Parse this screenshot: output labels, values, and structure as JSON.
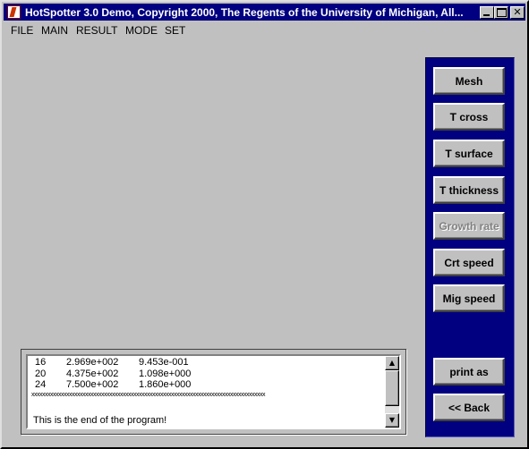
{
  "window": {
    "title": "HotSpotter 3.0 Demo,  Copyright 2000,  The Regents of the University of Michigan,  All...",
    "icon": "matlab-icon"
  },
  "menu": [
    "FILE",
    "MAIN",
    "RESULT",
    "MODE",
    "SET"
  ],
  "panel": {
    "color": "#000080",
    "buttons": [
      {
        "label": "Mesh",
        "enabled": true
      },
      {
        "label": "T cross",
        "enabled": true
      },
      {
        "label": "T surface",
        "enabled": true
      },
      {
        "label": "T thickness",
        "enabled": true
      },
      {
        "label": "Growth rate",
        "enabled": false
      },
      {
        "label": "Crt speed",
        "enabled": true
      },
      {
        "label": "Mig speed",
        "enabled": true
      }
    ],
    "print_label": "print as",
    "back_label": "<< Back"
  },
  "output": {
    "rows": [
      [
        "16",
        "2.969e+002",
        "9.453e-001"
      ],
      [
        "20",
        "4.375e+002",
        "1.098e+000"
      ],
      [
        "24",
        "7.500e+002",
        "1.860e+000"
      ]
    ],
    "separator": "xxxxxxxxxxxxxxxxxxxxxxxxxxxxxxxxxxxxxxxxxxxxxxxxxxxxxxxxxxxxxxxxxxxxxxxxxxxxxxxxxxxxxxx",
    "end_message": "This is the end of the program!"
  }
}
